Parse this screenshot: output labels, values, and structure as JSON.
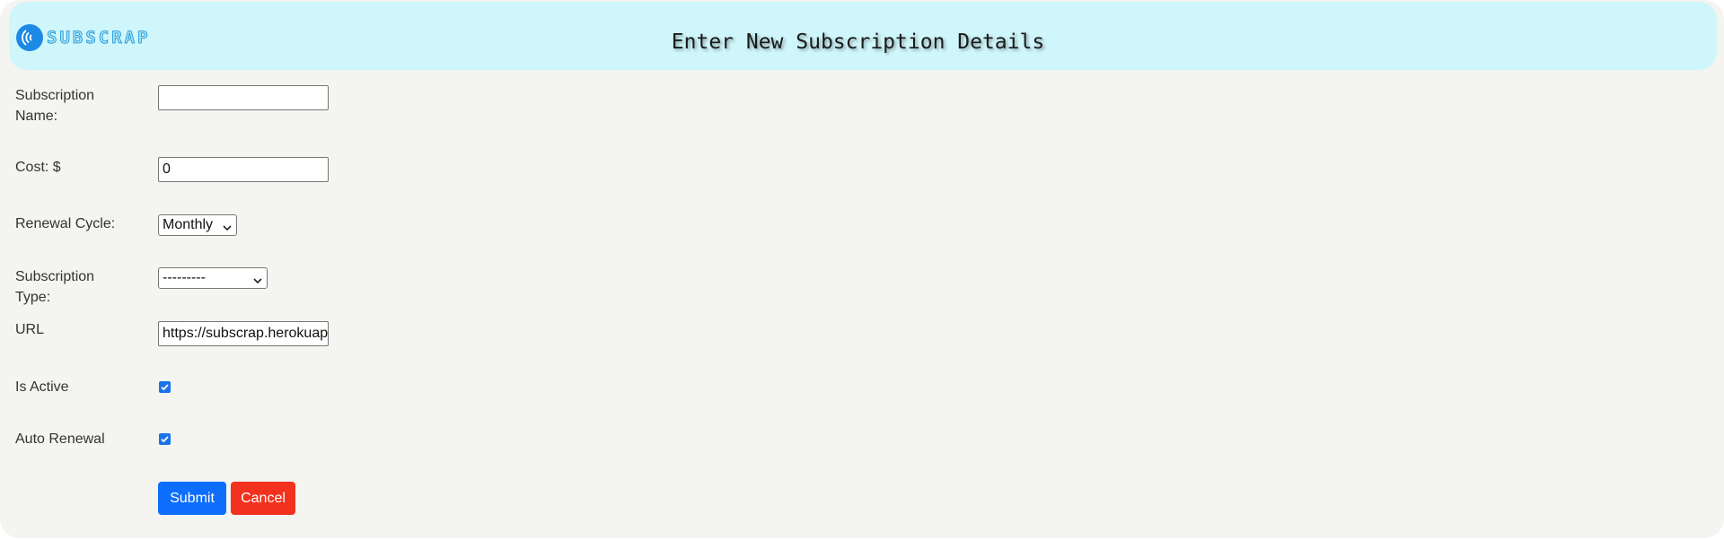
{
  "header": {
    "logo_text": "SUBSCRAP",
    "title": "Enter New Subscription Details"
  },
  "form": {
    "subscription_name": {
      "label": "Subscription Name:",
      "value": ""
    },
    "cost": {
      "label": "Cost: $",
      "value": "0"
    },
    "renewal_cycle": {
      "label": "Renewal Cycle:",
      "value": "Monthly"
    },
    "subscription_type": {
      "label": "Subscription Type:",
      "value": "---------"
    },
    "url": {
      "label": "URL",
      "value": "https://subscrap.herokuapp"
    },
    "is_active": {
      "label": "Is Active",
      "checked": true
    },
    "auto_renewal": {
      "label": "Auto Renewal",
      "checked": true
    },
    "submit_label": "Submit",
    "cancel_label": "Cancel"
  },
  "colors": {
    "header_bg": "#cff6fb",
    "page_bg": "#f4f4f1",
    "submit": "#0d6efd",
    "cancel": "#f2321e",
    "checkbox": "#1a73e8"
  }
}
